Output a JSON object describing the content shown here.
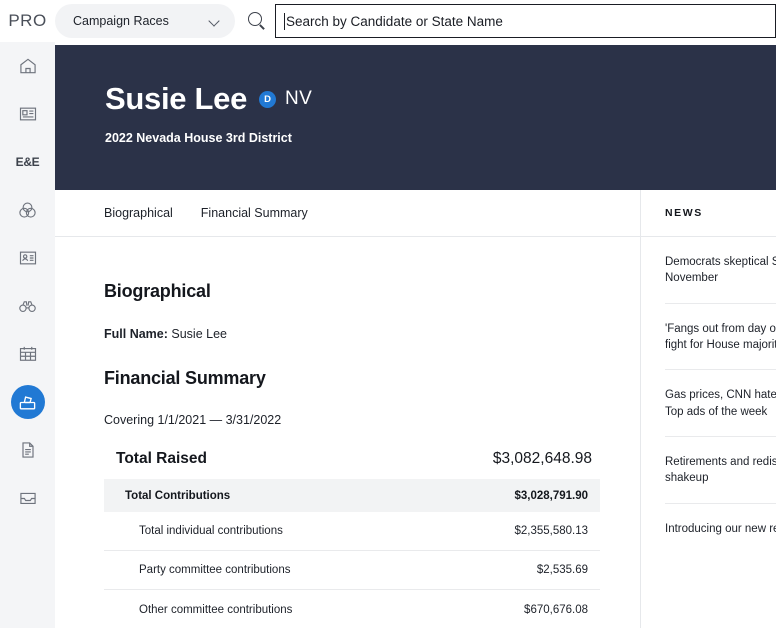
{
  "topbar": {
    "brand": "PRO",
    "race_select": {
      "value": "Campaign Races",
      "chevron_icon": "chevron-down-icon"
    },
    "search": {
      "icon": "search-icon",
      "placeholder": "Search by Candidate or State Name",
      "value": ""
    }
  },
  "sidebar": {
    "items": [
      {
        "icon": "home-icon",
        "label": "Home",
        "active": false
      },
      {
        "icon": "news-card-icon",
        "label": "News",
        "active": false
      },
      {
        "icon": "ee-text-icon",
        "label": "E&E",
        "active": false,
        "text": "E&E"
      },
      {
        "icon": "venn-icon",
        "label": "Intersection",
        "active": false
      },
      {
        "icon": "id-card-icon",
        "label": "Directory",
        "active": false
      },
      {
        "icon": "binoculars-icon",
        "label": "Watch",
        "active": false
      },
      {
        "icon": "calendar-icon",
        "label": "Calendar",
        "active": false
      },
      {
        "icon": "ballot-box-icon",
        "label": "Campaigns",
        "active": true
      },
      {
        "icon": "document-icon",
        "label": "Documents",
        "active": false
      },
      {
        "icon": "inbox-icon",
        "label": "Inbox",
        "active": false
      }
    ]
  },
  "hero": {
    "name": "Susie Lee",
    "party_badge": "D",
    "state": "NV",
    "subtitle": "2022 Nevada House 3rd District"
  },
  "tabs": [
    {
      "label": "Biographical"
    },
    {
      "label": "Financial Summary"
    }
  ],
  "main": {
    "biographical": {
      "heading": "Biographical",
      "full_name_label": "Full Name:",
      "full_name_value": "Susie Lee"
    },
    "financial": {
      "heading": "Financial Summary",
      "covering": "Covering 1/1/2021 — 3/31/2022",
      "total_raised_label": "Total Raised",
      "total_raised_value": "$3,082,648.98",
      "rows": [
        {
          "label": "Total Contributions",
          "value": "$3,028,791.90",
          "kind": "head"
        },
        {
          "label": "Total individual contributions",
          "value": "$2,355,580.13",
          "kind": "sub"
        },
        {
          "label": "Party committee contributions",
          "value": "$2,535.69",
          "kind": "sub"
        },
        {
          "label": "Other committee contributions",
          "value": "$670,676.08",
          "kind": "sub"
        }
      ]
    }
  },
  "news": {
    "heading": "NEWS",
    "items": [
      {
        "line1": "Democrats skeptical SC",
        "line2": "November"
      },
      {
        "line1": "'Fangs out from day one",
        "line2": "fight for House majority"
      },
      {
        "line1": "Gas prices, CNN haters",
        "line2": "Top ads of the week"
      },
      {
        "line1": "Retirements and redistr",
        "line2": "shakeup"
      },
      {
        "line1": "Introducing our new rec",
        "line2": ""
      }
    ]
  },
  "colors": {
    "hero_bg": "#2b3248",
    "accent_blue": "#2179d4",
    "rail_bg": "#f4f5f7",
    "row_head_bg": "#f2f3f4",
    "divider": "#e6e8eb"
  }
}
